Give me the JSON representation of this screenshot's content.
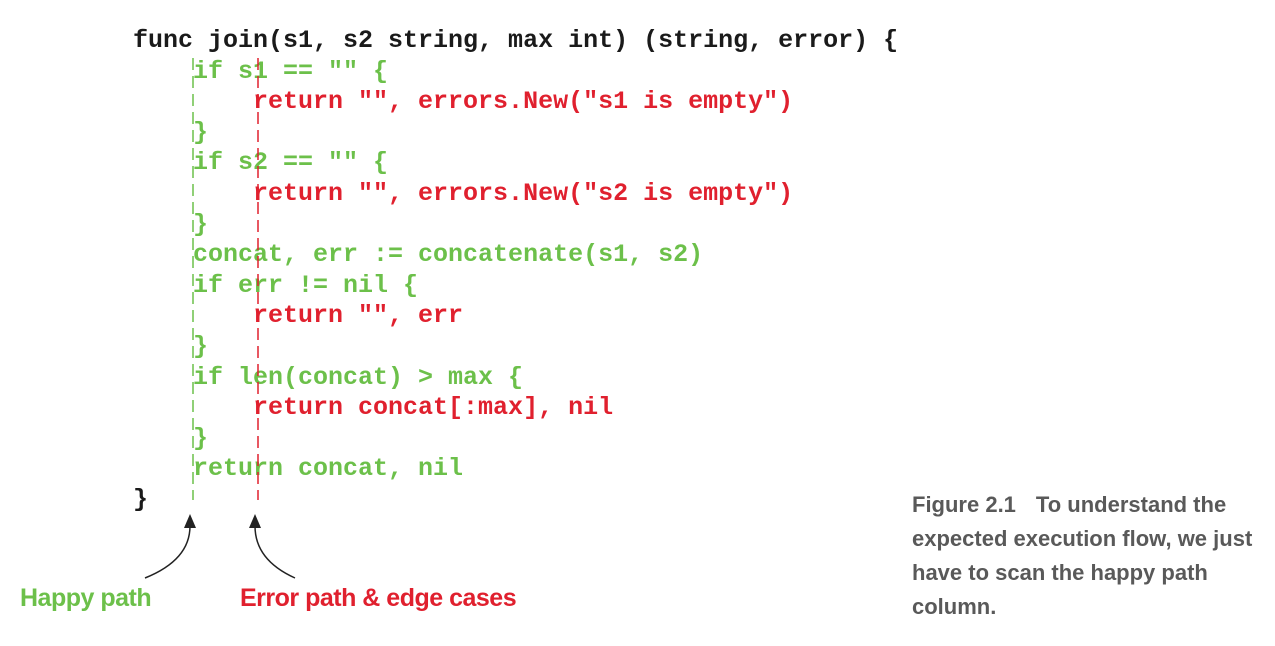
{
  "code_lines": [
    {
      "text": "func join(s1, s2 string, max int) (string, error) {",
      "color": "black"
    },
    {
      "text": "    if s1 == \"\" {",
      "color": "green"
    },
    {
      "text": "        return \"\", errors.New(\"s1 is empty\")",
      "color": "red"
    },
    {
      "text": "    }",
      "color": "green"
    },
    {
      "text": "    if s2 == \"\" {",
      "color": "green"
    },
    {
      "text": "        return \"\", errors.New(\"s2 is empty\")",
      "color": "red"
    },
    {
      "text": "    }",
      "color": "green"
    },
    {
      "text": "    concat, err := concatenate(s1, s2)",
      "color": "green"
    },
    {
      "text": "    if err != nil {",
      "color": "green"
    },
    {
      "text": "        return \"\", err",
      "color": "red"
    },
    {
      "text": "    }",
      "color": "green"
    },
    {
      "text": "    if len(concat) > max {",
      "color": "green"
    },
    {
      "text": "        return concat[:max], nil",
      "color": "red"
    },
    {
      "text": "    }",
      "color": "green"
    },
    {
      "text": "    return concat, nil",
      "color": "green"
    },
    {
      "text": "}",
      "color": "black"
    }
  ],
  "labels": {
    "happy_path": "Happy path",
    "error_path": "Error path & edge cases"
  },
  "caption": {
    "figure_number": "Figure 2.1",
    "text": "To understand the expected execution flow, we just have to scan the happy path column."
  },
  "colors": {
    "happy": "#6cc04a",
    "error": "#e0202e",
    "code_default": "#1a1a1a",
    "caption": "#595959"
  }
}
